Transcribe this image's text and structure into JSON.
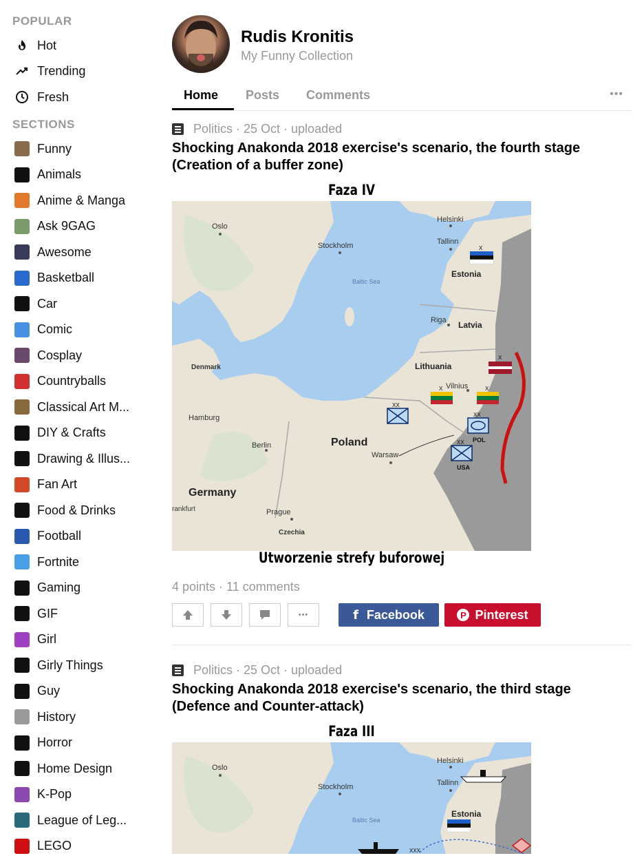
{
  "sidebar": {
    "popular_heading": "POPULAR",
    "popular": [
      {
        "label": "Hot",
        "icon": "flame-icon"
      },
      {
        "label": "Trending",
        "icon": "trending-icon"
      },
      {
        "label": "Fresh",
        "icon": "clock-icon"
      }
    ],
    "sections_heading": "SECTIONS",
    "sections": [
      {
        "label": "Funny",
        "color": "#8a6a4a"
      },
      {
        "label": "Animals",
        "color": "#111111"
      },
      {
        "label": "Anime & Manga",
        "color": "#e07a2a"
      },
      {
        "label": "Ask 9GAG",
        "color": "#7a9a6a"
      },
      {
        "label": "Awesome",
        "color": "#3a3a5a"
      },
      {
        "label": "Basketball",
        "color": "#2a6ad0"
      },
      {
        "label": "Car",
        "color": "#111111"
      },
      {
        "label": "Comic",
        "color": "#4a90e2"
      },
      {
        "label": "Cosplay",
        "color": "#6a4a6a"
      },
      {
        "label": "Countryballs",
        "color": "#d03030"
      },
      {
        "label": "Classical Art M...",
        "color": "#8a6a3a"
      },
      {
        "label": "DIY & Crafts",
        "color": "#111111"
      },
      {
        "label": "Drawing & Illus...",
        "color": "#111111"
      },
      {
        "label": "Fan Art",
        "color": "#d04a2a"
      },
      {
        "label": "Food & Drinks",
        "color": "#111111"
      },
      {
        "label": "Football",
        "color": "#2a5ab0"
      },
      {
        "label": "Fortnite",
        "color": "#4aa0e8"
      },
      {
        "label": "Gaming",
        "color": "#111111"
      },
      {
        "label": "GIF",
        "color": "#111111"
      },
      {
        "label": "Girl",
        "color": "#a040c0"
      },
      {
        "label": "Girly Things",
        "color": "#111111"
      },
      {
        "label": "Guy",
        "color": "#111111"
      },
      {
        "label": "History",
        "color": "#9a9a9a"
      },
      {
        "label": "Horror",
        "color": "#111111"
      },
      {
        "label": "Home Design",
        "color": "#111111"
      },
      {
        "label": "K-Pop",
        "color": "#8a4ab0"
      },
      {
        "label": "League of Leg...",
        "color": "#2a6a7a"
      },
      {
        "label": "LEGO",
        "color": "#d01010"
      }
    ]
  },
  "profile": {
    "name": "Rudis Kronitis",
    "subtitle": "My Funny Collection"
  },
  "tabs": [
    {
      "label": "Home",
      "active": true
    },
    {
      "label": "Posts",
      "active": false
    },
    {
      "label": "Comments",
      "active": false
    }
  ],
  "more_label": "•••",
  "posts": [
    {
      "meta": "Politics · 25 Oct · uploaded",
      "title": "Shocking Anakonda 2018 exercise's scenario, the fourth stage (Creation of a buffer zone)",
      "map_title": "Faza IV",
      "map_caption": "Utworzenie strefy buforowej",
      "map_labels": {
        "oslo": "Oslo",
        "stockholm": "Stockholm",
        "helsinki": "Helsinki",
        "tallinn": "Tallinn",
        "estonia": "Estonia",
        "baltic": "Baltic Sea",
        "riga": "Riga",
        "latvia": "Latvia",
        "denmark": "Denmark",
        "lithuania": "Lithuania",
        "vilnius": "Vilnius",
        "hamburg": "Hamburg",
        "berlin": "Berlin",
        "poland": "Poland",
        "warsaw": "Warsaw",
        "germany": "Germany",
        "frankfurt": "rankfurt",
        "prague": "Prague",
        "czechia": "Czechia",
        "pol": "POL",
        "usa": "USA",
        "xx": "XX",
        "x": "X"
      },
      "points": "4 points · 11 comments",
      "facebook": "Facebook",
      "pinterest": "Pinterest"
    },
    {
      "meta": "Politics · 25 Oct · uploaded",
      "title": "Shocking Anakonda 2018 exercise's scenario, the third stage (Defence and Counter-attack)",
      "map_title": "Faza III",
      "map_labels": {
        "oslo": "Oslo",
        "stockholm": "Stockholm",
        "helsinki": "Helsinki",
        "tallinn": "Tallinn",
        "estonia": "Estonia",
        "baltic": "Baltic Sea",
        "xxx": "XXX"
      }
    }
  ],
  "colors": {
    "facebook": "#3b5998",
    "pinterest": "#c8102e",
    "muted": "#999999"
  }
}
